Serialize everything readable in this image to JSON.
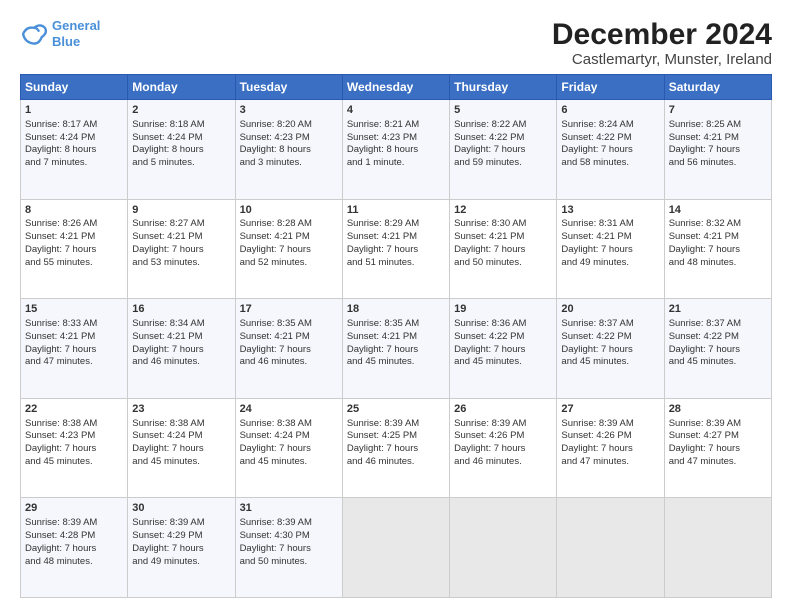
{
  "logo": {
    "line1": "General",
    "line2": "Blue"
  },
  "title": "December 2024",
  "subtitle": "Castlemartyr, Munster, Ireland",
  "days_of_week": [
    "Sunday",
    "Monday",
    "Tuesday",
    "Wednesday",
    "Thursday",
    "Friday",
    "Saturday"
  ],
  "weeks": [
    [
      {
        "day": 1,
        "lines": [
          "Sunrise: 8:17 AM",
          "Sunset: 4:24 PM",
          "Daylight: 8 hours",
          "and 7 minutes."
        ]
      },
      {
        "day": 2,
        "lines": [
          "Sunrise: 8:18 AM",
          "Sunset: 4:24 PM",
          "Daylight: 8 hours",
          "and 5 minutes."
        ]
      },
      {
        "day": 3,
        "lines": [
          "Sunrise: 8:20 AM",
          "Sunset: 4:23 PM",
          "Daylight: 8 hours",
          "and 3 minutes."
        ]
      },
      {
        "day": 4,
        "lines": [
          "Sunrise: 8:21 AM",
          "Sunset: 4:23 PM",
          "Daylight: 8 hours",
          "and 1 minute."
        ]
      },
      {
        "day": 5,
        "lines": [
          "Sunrise: 8:22 AM",
          "Sunset: 4:22 PM",
          "Daylight: 7 hours",
          "and 59 minutes."
        ]
      },
      {
        "day": 6,
        "lines": [
          "Sunrise: 8:24 AM",
          "Sunset: 4:22 PM",
          "Daylight: 7 hours",
          "and 58 minutes."
        ]
      },
      {
        "day": 7,
        "lines": [
          "Sunrise: 8:25 AM",
          "Sunset: 4:21 PM",
          "Daylight: 7 hours",
          "and 56 minutes."
        ]
      }
    ],
    [
      {
        "day": 8,
        "lines": [
          "Sunrise: 8:26 AM",
          "Sunset: 4:21 PM",
          "Daylight: 7 hours",
          "and 55 minutes."
        ]
      },
      {
        "day": 9,
        "lines": [
          "Sunrise: 8:27 AM",
          "Sunset: 4:21 PM",
          "Daylight: 7 hours",
          "and 53 minutes."
        ]
      },
      {
        "day": 10,
        "lines": [
          "Sunrise: 8:28 AM",
          "Sunset: 4:21 PM",
          "Daylight: 7 hours",
          "and 52 minutes."
        ]
      },
      {
        "day": 11,
        "lines": [
          "Sunrise: 8:29 AM",
          "Sunset: 4:21 PM",
          "Daylight: 7 hours",
          "and 51 minutes."
        ]
      },
      {
        "day": 12,
        "lines": [
          "Sunrise: 8:30 AM",
          "Sunset: 4:21 PM",
          "Daylight: 7 hours",
          "and 50 minutes."
        ]
      },
      {
        "day": 13,
        "lines": [
          "Sunrise: 8:31 AM",
          "Sunset: 4:21 PM",
          "Daylight: 7 hours",
          "and 49 minutes."
        ]
      },
      {
        "day": 14,
        "lines": [
          "Sunrise: 8:32 AM",
          "Sunset: 4:21 PM",
          "Daylight: 7 hours",
          "and 48 minutes."
        ]
      }
    ],
    [
      {
        "day": 15,
        "lines": [
          "Sunrise: 8:33 AM",
          "Sunset: 4:21 PM",
          "Daylight: 7 hours",
          "and 47 minutes."
        ]
      },
      {
        "day": 16,
        "lines": [
          "Sunrise: 8:34 AM",
          "Sunset: 4:21 PM",
          "Daylight: 7 hours",
          "and 46 minutes."
        ]
      },
      {
        "day": 17,
        "lines": [
          "Sunrise: 8:35 AM",
          "Sunset: 4:21 PM",
          "Daylight: 7 hours",
          "and 46 minutes."
        ]
      },
      {
        "day": 18,
        "lines": [
          "Sunrise: 8:35 AM",
          "Sunset: 4:21 PM",
          "Daylight: 7 hours",
          "and 45 minutes."
        ]
      },
      {
        "day": 19,
        "lines": [
          "Sunrise: 8:36 AM",
          "Sunset: 4:22 PM",
          "Daylight: 7 hours",
          "and 45 minutes."
        ]
      },
      {
        "day": 20,
        "lines": [
          "Sunrise: 8:37 AM",
          "Sunset: 4:22 PM",
          "Daylight: 7 hours",
          "and 45 minutes."
        ]
      },
      {
        "day": 21,
        "lines": [
          "Sunrise: 8:37 AM",
          "Sunset: 4:22 PM",
          "Daylight: 7 hours",
          "and 45 minutes."
        ]
      }
    ],
    [
      {
        "day": 22,
        "lines": [
          "Sunrise: 8:38 AM",
          "Sunset: 4:23 PM",
          "Daylight: 7 hours",
          "and 45 minutes."
        ]
      },
      {
        "day": 23,
        "lines": [
          "Sunrise: 8:38 AM",
          "Sunset: 4:24 PM",
          "Daylight: 7 hours",
          "and 45 minutes."
        ]
      },
      {
        "day": 24,
        "lines": [
          "Sunrise: 8:38 AM",
          "Sunset: 4:24 PM",
          "Daylight: 7 hours",
          "and 45 minutes."
        ]
      },
      {
        "day": 25,
        "lines": [
          "Sunrise: 8:39 AM",
          "Sunset: 4:25 PM",
          "Daylight: 7 hours",
          "and 46 minutes."
        ]
      },
      {
        "day": 26,
        "lines": [
          "Sunrise: 8:39 AM",
          "Sunset: 4:26 PM",
          "Daylight: 7 hours",
          "and 46 minutes."
        ]
      },
      {
        "day": 27,
        "lines": [
          "Sunrise: 8:39 AM",
          "Sunset: 4:26 PM",
          "Daylight: 7 hours",
          "and 47 minutes."
        ]
      },
      {
        "day": 28,
        "lines": [
          "Sunrise: 8:39 AM",
          "Sunset: 4:27 PM",
          "Daylight: 7 hours",
          "and 47 minutes."
        ]
      }
    ],
    [
      {
        "day": 29,
        "lines": [
          "Sunrise: 8:39 AM",
          "Sunset: 4:28 PM",
          "Daylight: 7 hours",
          "and 48 minutes."
        ]
      },
      {
        "day": 30,
        "lines": [
          "Sunrise: 8:39 AM",
          "Sunset: 4:29 PM",
          "Daylight: 7 hours",
          "and 49 minutes."
        ]
      },
      {
        "day": 31,
        "lines": [
          "Sunrise: 8:39 AM",
          "Sunset: 4:30 PM",
          "Daylight: 7 hours",
          "and 50 minutes."
        ]
      },
      null,
      null,
      null,
      null
    ]
  ]
}
